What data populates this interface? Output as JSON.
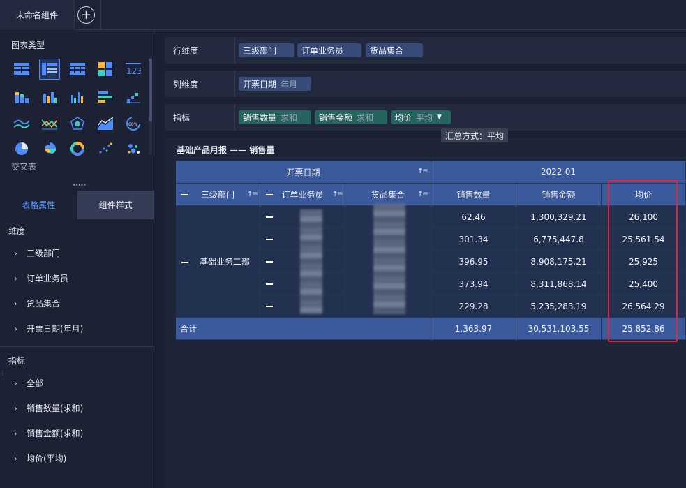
{
  "topbar": {
    "tab_label": "未命名组件",
    "add_symbol": "+"
  },
  "left": {
    "chart_type_title": "图表类型",
    "crosstab_label": "交叉表",
    "tabs": {
      "table_props": "表格属性",
      "component_style": "组件样式"
    },
    "dimension_title": "维度",
    "dimensions": [
      "三级部门",
      "订单业务员",
      "货品集合",
      "开票日期(年月)"
    ],
    "indicator_title": "指标",
    "indicators": [
      "全部",
      "销售数量(求和)",
      "销售金额(求和)",
      "均价(平均)"
    ]
  },
  "rows_dim": {
    "label": "行维度",
    "chips": [
      "三级部门",
      "订单业务员",
      "货品集合"
    ]
  },
  "cols_dim": {
    "label": "列维度",
    "chip": "开票日期",
    "chip_sub": "年月"
  },
  "metrics": {
    "label": "指标",
    "chips": [
      {
        "name": "销售数量",
        "agg": "求和"
      },
      {
        "name": "销售金额",
        "agg": "求和"
      },
      {
        "name": "均价",
        "agg": "平均"
      }
    ],
    "tooltip": "汇总方式：平均"
  },
  "report": {
    "title": "基础产品月报 —— 销售量",
    "header_date": "开票日期",
    "period": "2022-01",
    "col_dept": "三级部门",
    "col_salesman": "订单业务员",
    "col_goods": "货品集合",
    "col_qty": "销售数量",
    "col_amount": "销售金额",
    "col_avg": "均价",
    "dept_value": "基础业务二部",
    "rows": [
      {
        "qty": "62.46",
        "amount": "1,300,329.21",
        "avg": "26,100"
      },
      {
        "qty": "301.34",
        "amount": "6,775,447.8",
        "avg": "25,561.54"
      },
      {
        "qty": "396.95",
        "amount": "8,908,175.21",
        "avg": "25,925"
      },
      {
        "qty": "373.94",
        "amount": "8,311,868.14",
        "avg": "25,400"
      },
      {
        "qty": "229.28",
        "amount": "5,235,283.19",
        "avg": "26,564.29"
      }
    ],
    "total": {
      "label": "合计",
      "qty": "1,363.97",
      "amount": "30,531,103.55",
      "avg": "25,852.86"
    }
  }
}
